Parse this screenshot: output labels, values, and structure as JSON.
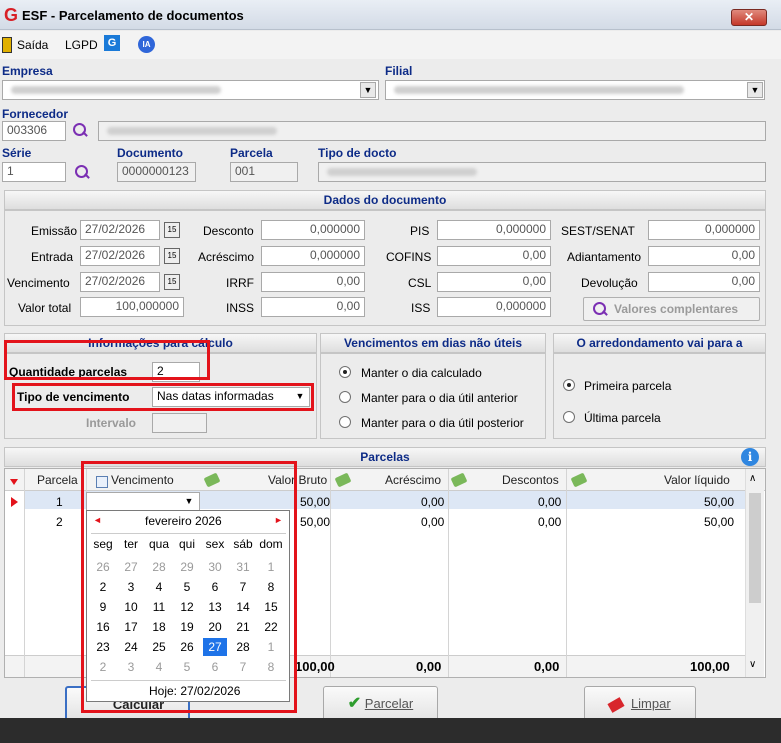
{
  "window": {
    "title": "ESF - Parcelamento de documentos",
    "close_label": "✕"
  },
  "menu": {
    "saida": "Saída",
    "lgpd": "LGPD",
    "g": "G",
    "ia": "IA"
  },
  "labels": {
    "empresa": "Empresa",
    "filial": "Filial",
    "fornecedor": "Fornecedor",
    "serie": "Série",
    "documento": "Documento",
    "parcela": "Parcela",
    "tipo_docto": "Tipo de docto"
  },
  "values": {
    "fornecedor_code": "003306",
    "serie": "1",
    "documento": "0000000123",
    "parcela": "001"
  },
  "dados": {
    "title": "Dados do documento",
    "emissao_label": "Emissão",
    "emissao": "27/02/2026",
    "entrada_label": "Entrada",
    "entrada": "27/02/2026",
    "vencimento_label": "Vencimento",
    "vencimento": "27/02/2026",
    "valor_total_label": "Valor total",
    "valor_total": "100,000000",
    "desconto_label": "Desconto",
    "desconto": "0,000000",
    "acrescimo_label": "Acréscimo",
    "acrescimo": "0,000000",
    "irrf_label": "IRRF",
    "irrf": "0,00",
    "inss_label": "INSS",
    "inss": "0,00",
    "pis_label": "PIS",
    "pis": "0,000000",
    "cofins_label": "COFINS",
    "cofins": "0,00",
    "csl_label": "CSL",
    "csl": "0,00",
    "iss_label": "ISS",
    "iss": "0,000000",
    "sest_label": "SEST/SENAT",
    "sest": "0,000000",
    "adiantamento_label": "Adiantamento",
    "adiantamento": "0,00",
    "devolucao_label": "Devolução",
    "devolucao": "0,00",
    "valores_btn": "Valores complentares"
  },
  "info": {
    "title": "Informações para cálculo",
    "qtd_label": "Quantidade parcelas",
    "qtd": "2",
    "tipo_label": "Tipo de vencimento",
    "tipo": "Nas datas informadas",
    "intervalo_label": "Intervalo"
  },
  "venc_uteis": {
    "title": "Vencimentos em dias não úteis",
    "opt1": "Manter o dia calculado",
    "opt2": "Manter para o dia útil anterior",
    "opt3": "Manter para o dia útil posterior"
  },
  "arred": {
    "title": "O arredondamento vai para a",
    "opt1": "Primeira parcela",
    "opt2": "Última parcela"
  },
  "parcelas": {
    "title": "Parcelas",
    "headers": {
      "parcela": "Parcela",
      "vencimento": "Vencimento",
      "valor_bruto": "Valor Bruto",
      "acrescimo": "Acréscimo",
      "descontos": "Descontos",
      "valor_liquido": "Valor líquido"
    },
    "rows": [
      {
        "parcela": "1",
        "valor_bruto": "50,00",
        "acrescimo": "0,00",
        "descontos": "0,00",
        "valor_liquido": "50,00"
      },
      {
        "parcela": "2",
        "valor_bruto": "50,00",
        "acrescimo": "0,00",
        "descontos": "0,00",
        "valor_liquido": "50,00"
      }
    ],
    "totals": {
      "valor_bruto": "100,00",
      "acrescimo": "0,00",
      "descontos": "0,00",
      "valor_liquido": "100,00"
    }
  },
  "calendar": {
    "month": "fevereiro 2026",
    "weekdays": [
      "seg",
      "ter",
      "qua",
      "qui",
      "sex",
      "sáb",
      "dom"
    ],
    "weeks": [
      [
        "26",
        "27",
        "28",
        "29",
        "30",
        "31",
        "1"
      ],
      [
        "2",
        "3",
        "4",
        "5",
        "6",
        "7",
        "8"
      ],
      [
        "9",
        "10",
        "11",
        "12",
        "13",
        "14",
        "15"
      ],
      [
        "16",
        "17",
        "18",
        "19",
        "20",
        "21",
        "22"
      ],
      [
        "23",
        "24",
        "25",
        "26",
        "27",
        "28",
        "1"
      ],
      [
        "2",
        "3",
        "4",
        "5",
        "6",
        "7",
        "8"
      ]
    ],
    "today": "Hoje: 27/02/2026"
  },
  "buttons": {
    "calcular": "Calcular",
    "parcelar": "Parcelar",
    "limpar": "Limpar"
  },
  "colors": {
    "accent": "#0d2b87",
    "highlight": "#e3131b",
    "selected_day": "#1e73e8"
  }
}
